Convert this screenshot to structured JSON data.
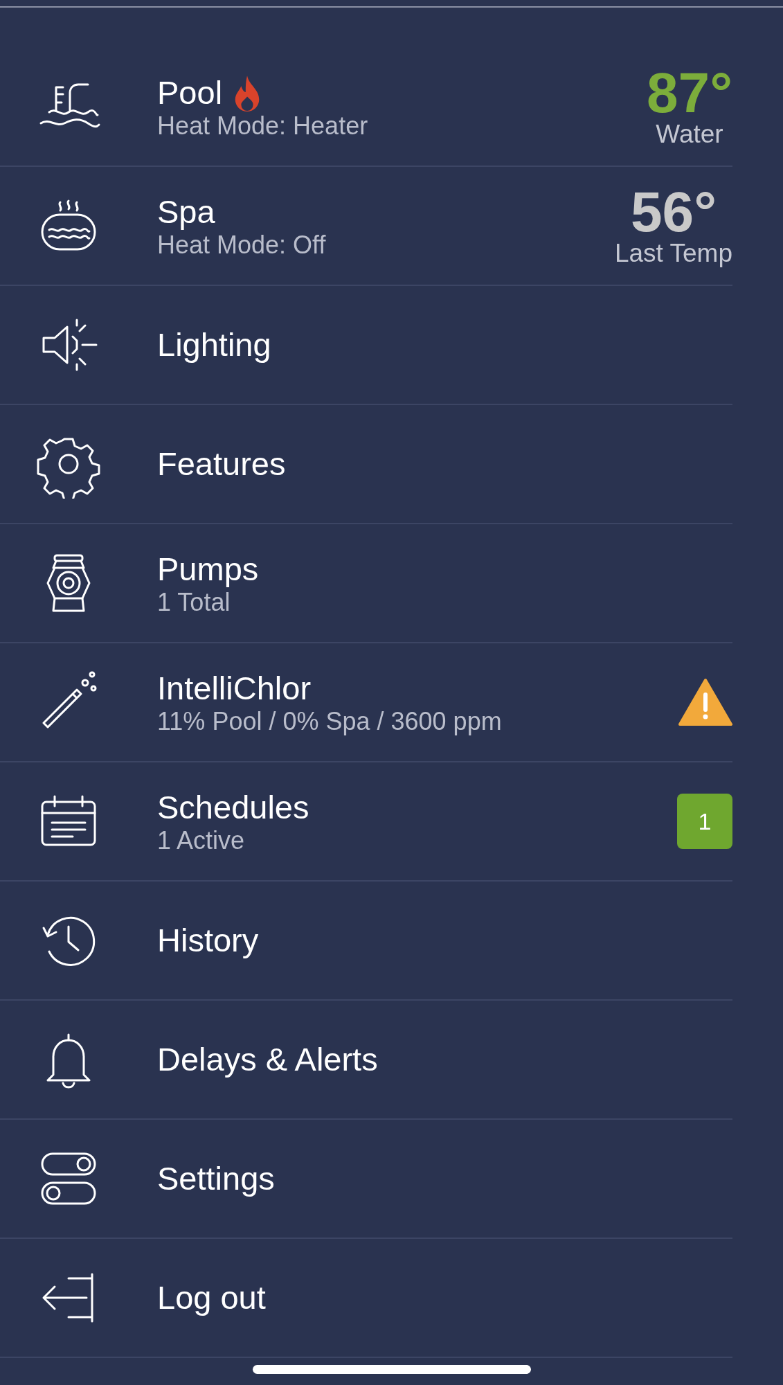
{
  "menu": [
    {
      "title": "Pool",
      "heating": true,
      "subtitle": "Heat Mode: Heater",
      "reading": {
        "value": "87°",
        "label": "Water",
        "color": "#7cad3b"
      }
    },
    {
      "title": "Spa",
      "heating": false,
      "subtitle": "Heat Mode: Off",
      "reading": {
        "value": "56°",
        "label": "Last Temp",
        "color": "#c9c9c9"
      }
    },
    {
      "title": "Lighting"
    },
    {
      "title": "Features"
    },
    {
      "title": "Pumps",
      "subtitle": "1 Total"
    },
    {
      "title": "IntelliChlor",
      "subtitle": "11% Pool / 0% Spa / 3600 ppm",
      "alert": true
    },
    {
      "title": "Schedules",
      "subtitle": "1 Active",
      "badge": "1"
    },
    {
      "title": "History"
    },
    {
      "title": "Delays & Alerts"
    },
    {
      "title": "Settings"
    },
    {
      "title": "Log out"
    }
  ]
}
